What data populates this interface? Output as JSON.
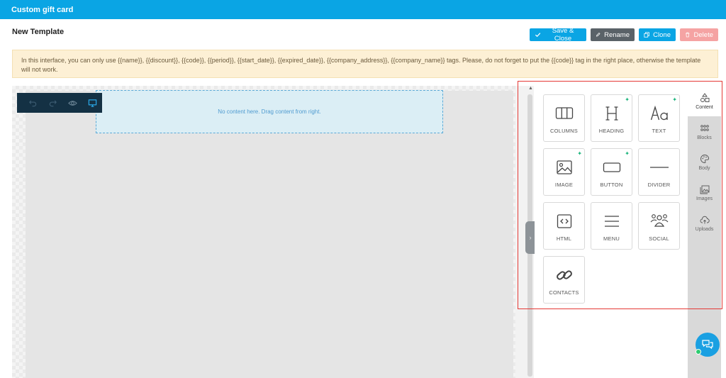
{
  "app": {
    "title": "Custom gift card"
  },
  "page": {
    "title": "New Template"
  },
  "actions": {
    "save_label": "Save & Close",
    "rename_label": "Rename",
    "clone_label": "Clone",
    "delete_label": "Delete"
  },
  "notice": {
    "text": "In this interface, you can only use {{name}}, {{discount}}, {{code}}, {{period}}, {{start_date}}, {{expired_date}}, {{company_address}}, {{company_name}} tags. Please, do not forget to put the {{code}} tag in the right place, otherwise the template will not work."
  },
  "editor": {
    "dropzone_text": "No content here. Drag content from right.",
    "toolbar_icons": [
      "undo-icon",
      "redo-icon",
      "preview-eye-icon",
      "desktop-icon"
    ]
  },
  "tools": [
    {
      "label": "COLUMNS",
      "icon": "columns-icon",
      "badge": false
    },
    {
      "label": "HEADING",
      "icon": "heading-icon",
      "badge": true
    },
    {
      "label": "TEXT",
      "icon": "text-icon",
      "badge": true
    },
    {
      "label": "IMAGE",
      "icon": "image-icon",
      "badge": true
    },
    {
      "label": "BUTTON",
      "icon": "button-icon",
      "badge": true
    },
    {
      "label": "DIVIDER",
      "icon": "divider-icon",
      "badge": false
    },
    {
      "label": "HTML",
      "icon": "html-icon",
      "badge": false
    },
    {
      "label": "MENU",
      "icon": "menu-icon",
      "badge": false
    },
    {
      "label": "SOCIAL",
      "icon": "social-icon",
      "badge": false
    },
    {
      "label": "CONTACTS",
      "icon": "link-icon",
      "badge": false
    }
  ],
  "side_tabs": [
    {
      "label": "Content",
      "icon": "shapes-icon",
      "active": true
    },
    {
      "label": "Blocks",
      "icon": "blocks-icon",
      "active": false
    },
    {
      "label": "Body",
      "icon": "palette-icon",
      "active": false
    },
    {
      "label": "Images",
      "icon": "images-icon",
      "active": false
    },
    {
      "label": "Uploads",
      "icon": "cloud-upload-icon",
      "active": false
    }
  ],
  "colors": {
    "brand": "#0aa5e4",
    "toolbar": "#143144",
    "delete": "#f5a3a3",
    "highlight": "#e53935",
    "badge": "#18b37a"
  }
}
